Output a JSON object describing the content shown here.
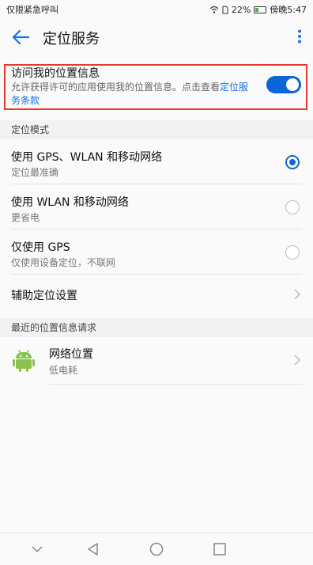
{
  "status_bar": {
    "carrier": "仅限紧急呼叫",
    "battery": "22%",
    "time": "傍晚5:47"
  },
  "app_bar": {
    "title": "定位服务"
  },
  "location_access": {
    "title": "访问我的位置信息",
    "description_prefix": "允许获得许可的应用使用我的位置信息。点击查看",
    "description_link": "定位服务条款",
    "enabled": true
  },
  "mode_section": {
    "header": "定位模式",
    "options": [
      {
        "title": "使用 GPS、WLAN 和移动网络",
        "subtitle": "定位最准确",
        "selected": true
      },
      {
        "title": "使用 WLAN 和移动网络",
        "subtitle": "更省电",
        "selected": false
      },
      {
        "title": "仅使用 GPS",
        "subtitle": "仅使用设备定位，不联网",
        "selected": false
      }
    ],
    "assist_label": "辅助定位设置"
  },
  "recent_section": {
    "header": "最近的位置信息请求",
    "items": [
      {
        "icon": "android-icon",
        "title": "网络位置",
        "subtitle": "低电耗"
      }
    ]
  },
  "colors": {
    "accent": "#0a66d8",
    "highlight_border": "#e53935",
    "android_green": "#8bc34a"
  }
}
